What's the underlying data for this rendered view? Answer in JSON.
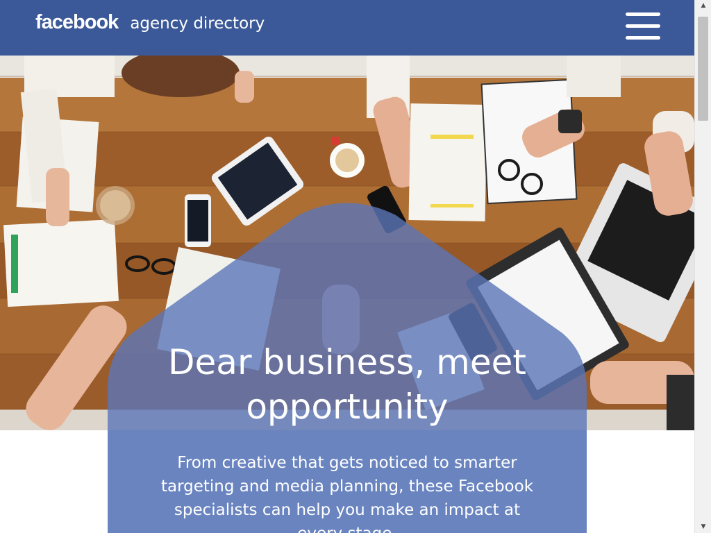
{
  "header": {
    "logo": "facebook",
    "subtitle": "agency directory",
    "menu_icon": "hamburger-menu-icon"
  },
  "hero": {
    "headline_line1": "Dear business, meet",
    "headline_line2": "opportunity",
    "subcopy_line1": "From creative that gets noticed to smarter",
    "subcopy_line2": "targeting and media planning, these Facebook",
    "subcopy_line3": "specialists can help you make an impact at",
    "subcopy_line4": "every stage."
  },
  "colors": {
    "brand_blue": "#3b5998",
    "overlay_blue": "#5b76b8"
  }
}
